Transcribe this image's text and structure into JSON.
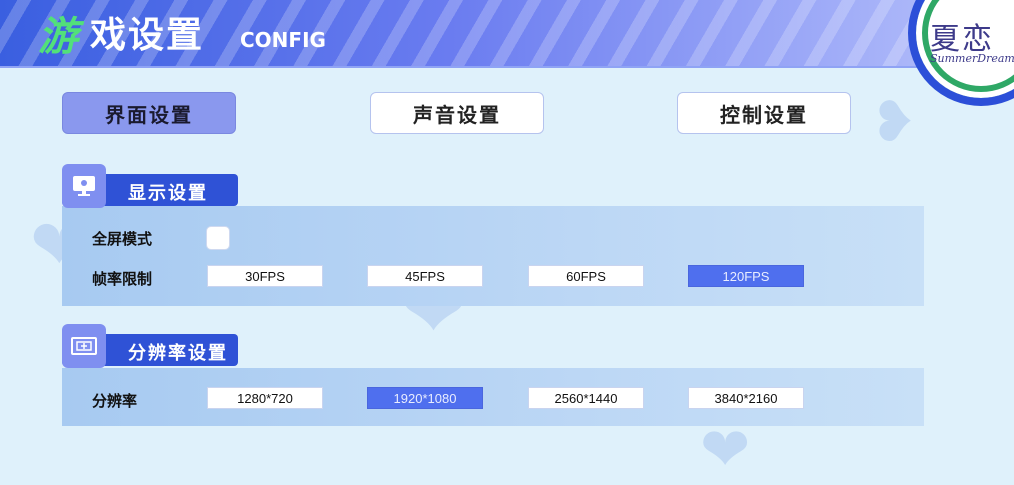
{
  "header": {
    "title_first_char": "游",
    "title_rest": "戏设置",
    "title_en": "CONFIG"
  },
  "logo": {
    "cn": "夏恋",
    "en": "SummerDream"
  },
  "tabs": [
    {
      "label": "界面设置",
      "active": true
    },
    {
      "label": "声音设置",
      "active": false
    },
    {
      "label": "控制设置",
      "active": false
    }
  ],
  "display_section": {
    "title": "显示设置",
    "icon": "monitor-icon",
    "fullscreen_label": "全屏模式",
    "fullscreen_checked": false,
    "framerate_label": "帧率限制",
    "framerate_options": [
      "30FPS",
      "45FPS",
      "60FPS",
      "120FPS"
    ],
    "framerate_selected": "120FPS"
  },
  "resolution_section": {
    "title": "分辨率设置",
    "icon": "screen-icon",
    "resolution_label": "分辨率",
    "resolution_options": [
      "1280*720",
      "1920*1080",
      "2560*1440",
      "3840*2160"
    ],
    "resolution_selected": "1920*1080"
  },
  "colors": {
    "accent": "#2f52d6",
    "selected": "#4f6fee",
    "tab_active": "#8a98ee",
    "title_green": "#52e07a"
  }
}
